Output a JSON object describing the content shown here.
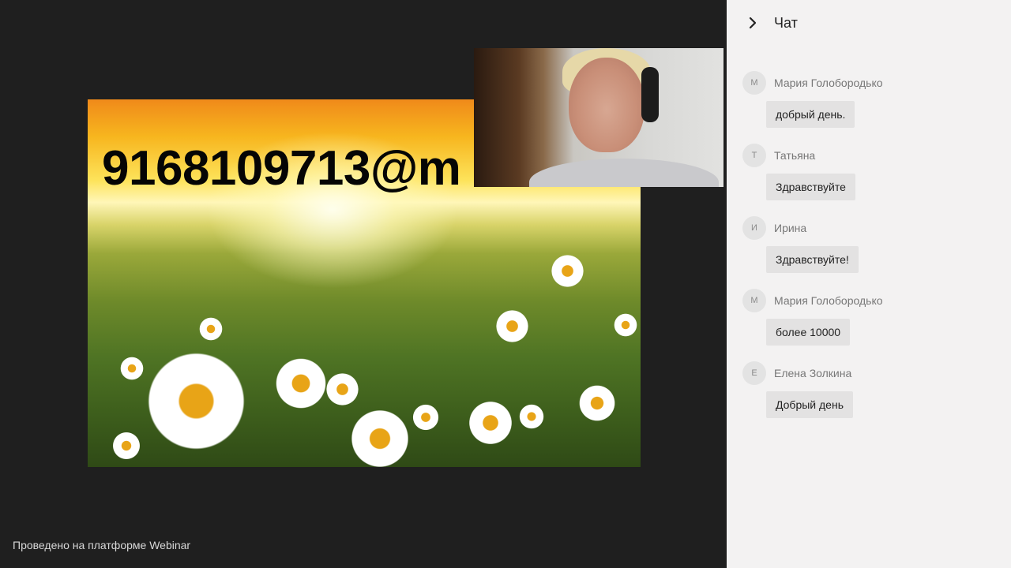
{
  "footer": {
    "platform_note": "Проведено на платформе Webinar"
  },
  "slide": {
    "visible_text": "9168109713@m"
  },
  "chat": {
    "title": "Чат",
    "toggle_icon": "chevron-right-icon",
    "messages": [
      {
        "initial": "М",
        "author": "Мария Голобородько",
        "text": "добрый день."
      },
      {
        "initial": "Т",
        "author": "Татьяна",
        "text": "Здравствуйте"
      },
      {
        "initial": "И",
        "author": "Ирина",
        "text": "Здравствуйте!"
      },
      {
        "initial": "М",
        "author": "Мария Голобородько",
        "text": "более 10000"
      },
      {
        "initial": "Е",
        "author": "Елена Золкина",
        "text": "Добрый день"
      }
    ]
  },
  "colors": {
    "stage_background": "#1f1f1f",
    "chat_background": "#f3f2f2",
    "bubble_background": "#e3e2e2",
    "avatar_background": "#e3e3e3"
  }
}
